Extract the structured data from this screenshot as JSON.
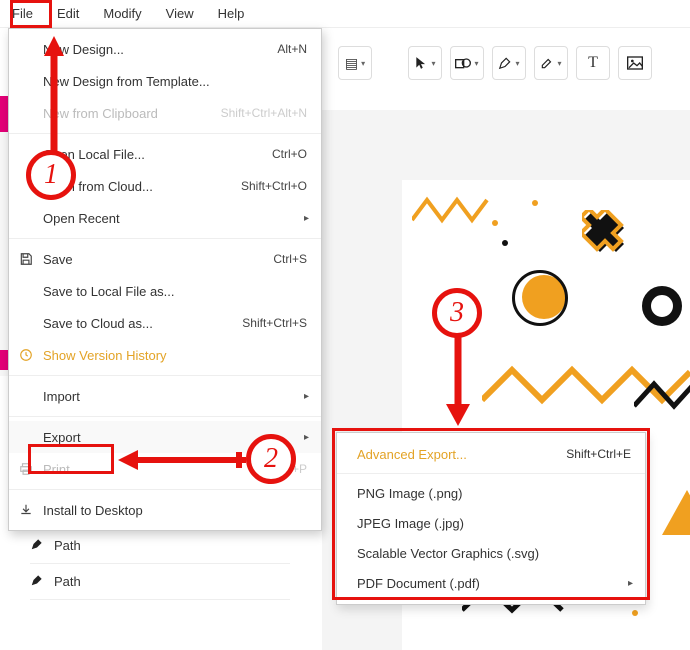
{
  "menubar": {
    "items": [
      "File",
      "Edit",
      "Modify",
      "View",
      "Help"
    ],
    "active_index": 0
  },
  "file_menu": {
    "groups": [
      {
        "kind": "item",
        "label": "New Design...",
        "shortcut": "Alt+N",
        "icon": ""
      },
      {
        "kind": "item",
        "label": "New Design from Template...",
        "shortcut": "",
        "icon": ""
      },
      {
        "kind": "item",
        "label": "New from Clipboard",
        "shortcut": "Shift+Ctrl+Alt+N",
        "icon": "",
        "disabled": true
      },
      {
        "kind": "sep"
      },
      {
        "kind": "item",
        "label": "Open Local File...",
        "shortcut": "Ctrl+O",
        "icon": ""
      },
      {
        "kind": "item",
        "label": "Open from Cloud...",
        "shortcut": "Shift+Ctrl+O",
        "icon": ""
      },
      {
        "kind": "item",
        "label": "Open Recent",
        "shortcut": "",
        "submenu": true,
        "icon": ""
      },
      {
        "kind": "sep"
      },
      {
        "kind": "item",
        "label": "Save",
        "shortcut": "Ctrl+S",
        "icon": "save"
      },
      {
        "kind": "item",
        "label": "Save to Local File as...",
        "shortcut": "",
        "icon": ""
      },
      {
        "kind": "item",
        "label": "Save to Cloud as...",
        "shortcut": "Shift+Ctrl+S",
        "icon": ""
      },
      {
        "kind": "item",
        "label": "Show Version History",
        "shortcut": "",
        "icon": "history",
        "history_style": true
      },
      {
        "kind": "sep"
      },
      {
        "kind": "item",
        "label": "Import",
        "shortcut": "",
        "submenu": true,
        "icon": ""
      },
      {
        "kind": "sep"
      },
      {
        "kind": "item",
        "label": "Export",
        "shortcut": "",
        "submenu": true,
        "highlight": true,
        "icon": ""
      },
      {
        "kind": "item",
        "label": "Print...",
        "shortcut": "Ctrl+P",
        "icon": "print",
        "disabled": true
      },
      {
        "kind": "sep"
      },
      {
        "kind": "item",
        "label": "Install to Desktop",
        "shortcut": "",
        "icon": "install"
      }
    ]
  },
  "export_submenu": {
    "items": [
      {
        "label": "Advanced Export...",
        "shortcut": "Shift+Ctrl+E",
        "highlight": true
      },
      {
        "label": "PNG Image (.png)",
        "shortcut": ""
      },
      {
        "label": "JPEG Image (.jpg)",
        "shortcut": ""
      },
      {
        "label": "Scalable Vector Graphics (.svg)",
        "shortcut": ""
      },
      {
        "label": "PDF Document (.pdf)",
        "shortcut": "",
        "submenu": true
      }
    ]
  },
  "toolbar": {
    "tools": [
      "cursor",
      "shape",
      "pen",
      "eyedropper",
      "text",
      "image"
    ]
  },
  "layers": {
    "items": [
      {
        "icon": "pen",
        "label": "Path"
      },
      {
        "icon": "pen",
        "label": "Path"
      }
    ]
  },
  "annotations": {
    "step1": "1",
    "step2": "2",
    "step3": "3"
  },
  "colors": {
    "accent_red": "#e6120e",
    "accent_orange": "#f0a020",
    "accent_pink": "#e30077"
  }
}
